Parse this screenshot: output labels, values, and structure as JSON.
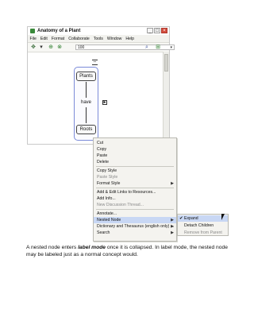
{
  "window": {
    "title": "Anatomy of a Plant",
    "menu": [
      "File",
      "Edit",
      "Format",
      "Collaborate",
      "Tools",
      "Window",
      "Help"
    ],
    "zoom_value": "100",
    "buttons": {
      "minimize": "_",
      "maximize": "□",
      "close": "×"
    }
  },
  "concept_map": {
    "top_concept": "Plants",
    "link_phrase": "have",
    "bottom_concept": "Roots"
  },
  "context_menu": {
    "items": [
      {
        "label": "Cut",
        "disabled": false
      },
      {
        "label": "Copy",
        "disabled": false
      },
      {
        "label": "Paste",
        "disabled": false
      },
      {
        "label": "Delete",
        "disabled": false
      },
      {
        "label": "Copy Style",
        "disabled": false
      },
      {
        "label": "Paste Style",
        "disabled": true
      },
      {
        "label": "Format Style",
        "disabled": false,
        "submenu": true
      },
      {
        "label": "Add & Edit Links to Resources...",
        "disabled": false
      },
      {
        "label": "Add Info...",
        "disabled": false
      },
      {
        "label": "New Discussion Thread...",
        "disabled": true
      },
      {
        "label": "Annotate...",
        "disabled": false
      },
      {
        "label": "Nested Node",
        "disabled": false,
        "submenu": true,
        "highlighted": true
      },
      {
        "label": "Dictionary and Thesaurus (english only) ...",
        "disabled": false,
        "submenu": true
      },
      {
        "label": "Search",
        "disabled": false,
        "submenu": true
      }
    ],
    "nested_submenu": [
      {
        "label": "Expand",
        "checked": true,
        "highlighted": true
      },
      {
        "label": "Detach Children",
        "checked": false
      },
      {
        "label": "Remove from Parent",
        "disabled": true
      }
    ]
  },
  "caption": {
    "before": "A nested node enters ",
    "emphasis": "label mode",
    "after": " once it is collapsed. In label mode, the nested node may be labeled just as a normal concept would."
  }
}
